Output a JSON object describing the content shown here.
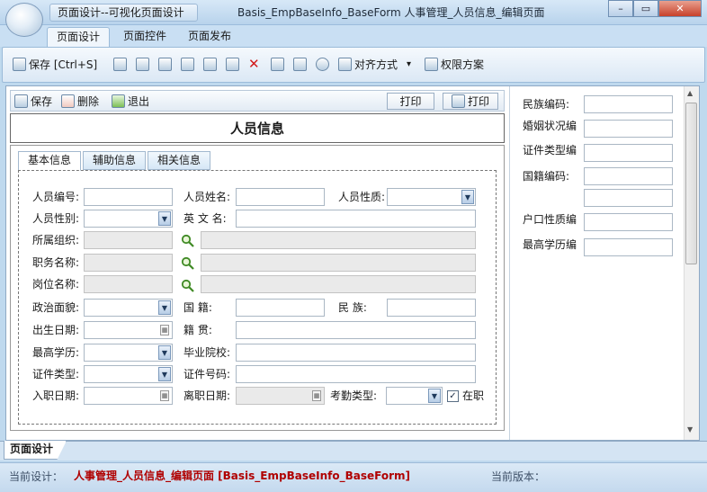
{
  "window": {
    "qat_title": "页面设计--可视化页面设计",
    "title": "Basis_EmpBaseInfo_BaseForm  人事管理_人员信息_编辑页面",
    "minimize_glyph": "–",
    "restore_glyph": "▭",
    "close_glyph": "✕"
  },
  "ribbon": {
    "tabs": [
      "页面设计",
      "页面控件",
      "页面发布"
    ],
    "save_label": "保存 [Ctrl+S]",
    "align_label": "对齐方式",
    "permission_label": "权限方案",
    "dropdown_glyph": "▾"
  },
  "form_toolbar": {
    "save": "保存",
    "delete": "删除",
    "exit": "退出",
    "print1": "打印",
    "print2": "打印"
  },
  "form_title": "人员信息",
  "form_tabs": [
    "基本信息",
    "辅助信息",
    "相关信息"
  ],
  "fields": {
    "emp_no": "人员编号:",
    "emp_name": "人员姓名:",
    "emp_nature": "人员性质:",
    "gender": "人员性别:",
    "english_name": "英 文 名:",
    "org": "所属组织:",
    "job_title": "职务名称:",
    "post": "岗位名称:",
    "politics": "政治面貌:",
    "nationality": "国      籍:",
    "ethnic": "民      族:",
    "birth_date": "出生日期:",
    "native_place": "籍      贯:",
    "education": "最高学历:",
    "school": "毕业院校:",
    "cert_type": "证件类型:",
    "cert_no": "证件号码:",
    "entry_date": "入职日期:",
    "leave_date": "离职日期:",
    "attendance_type": "考勤类型:",
    "on_job": "在职"
  },
  "right_panel": {
    "labels": [
      "民族编码:",
      "婚姻状况编",
      "证件类型编",
      "国籍编码:",
      "",
      "户口性质编",
      "最高学历编"
    ]
  },
  "bottom_tab": "页面设计",
  "status": {
    "current_label": "当前设计：",
    "current_value": "人事管理_人员信息_编辑页面 [Basis_EmpBaseInfo_BaseForm]",
    "version_label": "当前版本："
  },
  "icons": {
    "combo": "▼",
    "date": "▦",
    "check": "✓",
    "scroll_up": "▲",
    "scroll_down": "▼",
    "magnifier": "magnifier-icon"
  }
}
